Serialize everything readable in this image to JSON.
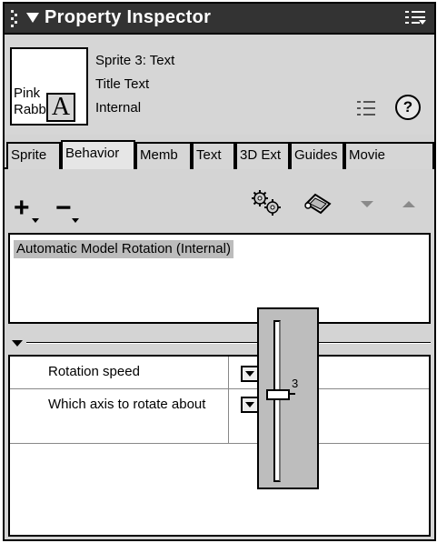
{
  "window": {
    "title": "Property Inspector"
  },
  "sprite": {
    "name_line": "Sprite 3: Text",
    "member_line": "Title Text",
    "cast_line": "Internal",
    "thumbnail_line1": "Pink",
    "thumbnail_line2": "Rabb",
    "thumbnail_glyph": "A"
  },
  "tabs": [
    {
      "label": "Sprite",
      "active": false
    },
    {
      "label": "Behavior",
      "active": true
    },
    {
      "label": "Memb",
      "active": false
    },
    {
      "label": "Text",
      "active": false
    },
    {
      "label": "3D Ext",
      "active": false
    },
    {
      "label": "Guides",
      "active": false
    },
    {
      "label": "Movie",
      "active": false
    }
  ],
  "toolbar": {
    "add_label": "+",
    "remove_label": "−"
  },
  "behaviors": [
    {
      "label": "Automatic Model Rotation (Internal)",
      "selected": true
    }
  ],
  "parameters": [
    {
      "name": "Rotation speed",
      "value": "3"
    },
    {
      "name": "Which axis to rotate about",
      "value": ""
    }
  ],
  "slider": {
    "value_label": "3",
    "level": 0.46
  },
  "icons": {
    "grip": "drag-grip-icon",
    "title_collapse": "triangle-down-icon",
    "panel_menu": "panel-options-icon",
    "list_view": "list-view-icon",
    "help": "help-icon",
    "behavior_inspector": "gears-icon",
    "script": "script-icon",
    "move_down": "triangle-down-icon",
    "move_up": "triangle-up-icon"
  }
}
